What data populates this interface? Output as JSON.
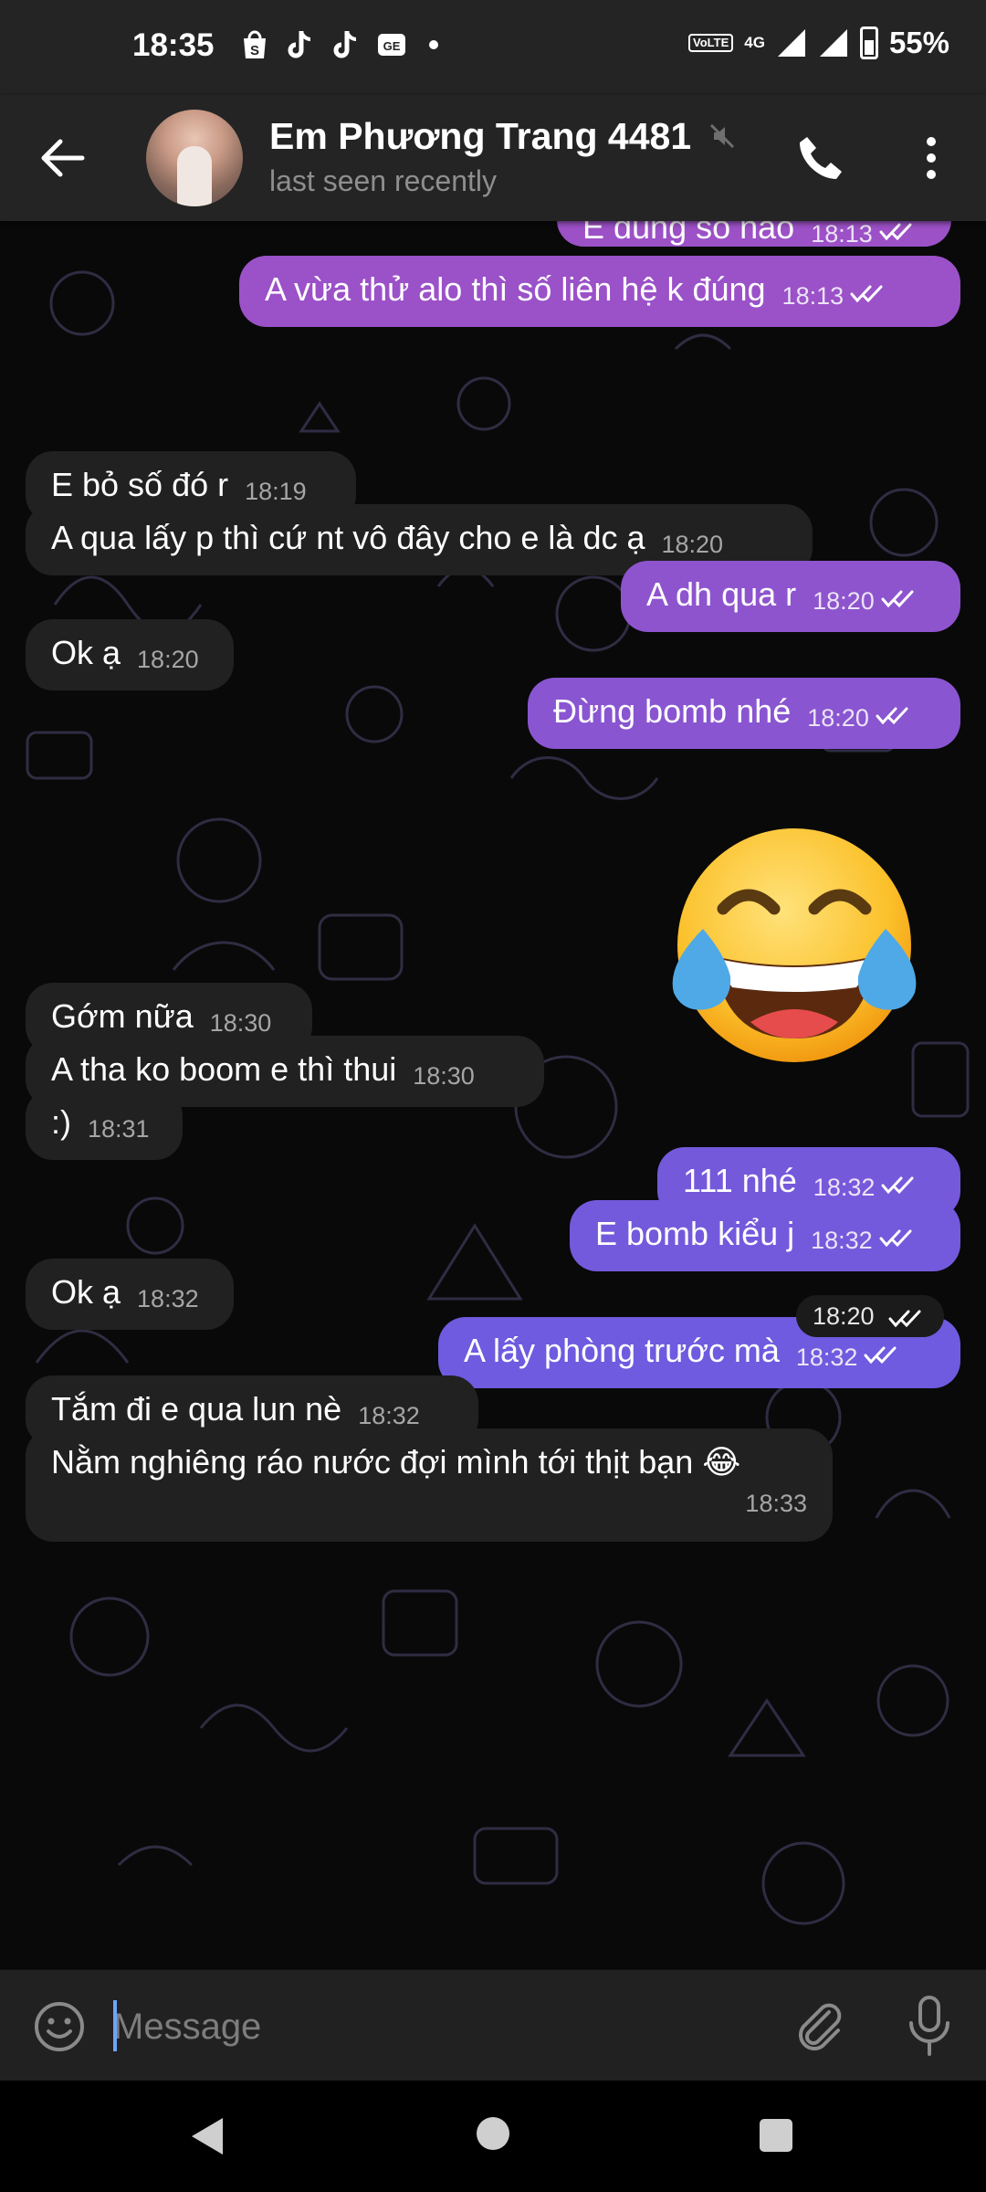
{
  "status_bar": {
    "time": "18:35",
    "app_icons": [
      "shopee-icon",
      "tiktok-icon",
      "tiktok-icon",
      "ge-icon"
    ],
    "network": "4G",
    "volte": "VoLTE",
    "battery_percent": "55%",
    "battery_level": 0.55
  },
  "header": {
    "name": "Em Phương Trang 4481",
    "last_seen": "last seen recently",
    "muted": true
  },
  "colors": {
    "background": "#090909",
    "bar": "#242424",
    "incoming_bubble": "#212121",
    "outgoing_top": "#9c51c7",
    "outgoing_bottom": "#6c5be0"
  },
  "messages": [
    {
      "dir": "out",
      "text": "E dùng số nào",
      "time": "18:13",
      "read": true,
      "partial": true
    },
    {
      "dir": "out",
      "text": "A vừa thử alo thì số liên hệ k đúng",
      "time": "18:13",
      "read": true
    },
    {
      "dir": "in",
      "text": "E bỏ số đó r",
      "time": "18:19"
    },
    {
      "dir": "in",
      "text": "A qua lấy p thì cứ nt vô đây cho e là dc ạ",
      "time": "18:20"
    },
    {
      "dir": "out",
      "text": "A dh qua r",
      "time": "18:20",
      "read": true
    },
    {
      "dir": "in",
      "text": "Ok ạ",
      "time": "18:20"
    },
    {
      "dir": "out",
      "text": "Đừng bomb nhé",
      "time": "18:20",
      "read": true
    },
    {
      "dir": "out",
      "sticker": "tears-of-joy-emoji",
      "time": "18:20",
      "read": true
    },
    {
      "dir": "in",
      "text": "Gớm nữa",
      "time": "18:30"
    },
    {
      "dir": "in",
      "text": "A tha ko boom e thì thui",
      "time": "18:30"
    },
    {
      "dir": "in",
      "text": ":)",
      "time": "18:31"
    },
    {
      "dir": "out",
      "text": "111 nhé",
      "time": "18:32",
      "read": true
    },
    {
      "dir": "out",
      "text": "E bomb kiểu j",
      "time": "18:32",
      "read": true
    },
    {
      "dir": "in",
      "text": "Ok ạ",
      "time": "18:32"
    },
    {
      "dir": "out",
      "text": "A lấy phòng trước mà",
      "time": "18:32",
      "read": true
    },
    {
      "dir": "in",
      "text": "Tắm đi e qua lun nè",
      "time": "18:32"
    },
    {
      "dir": "in",
      "text": "Nằm nghiêng ráo nước đợi mình tới thịt bạn 😂",
      "time": "18:33"
    }
  ],
  "input": {
    "placeholder": "Message",
    "value": ""
  }
}
